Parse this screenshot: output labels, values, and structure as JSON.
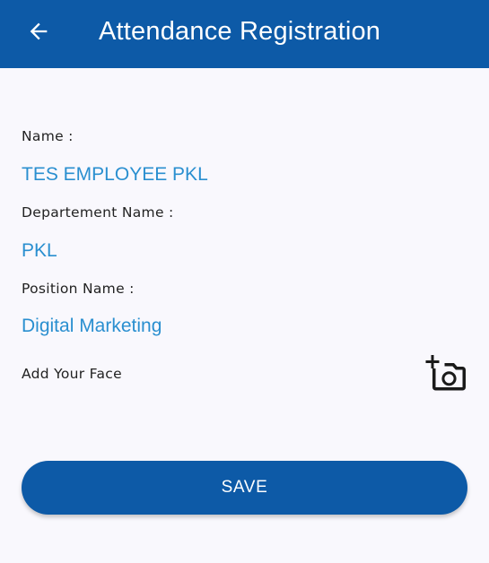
{
  "app_bar": {
    "title": "Attendance Registration",
    "back_icon": "arrow-left-icon",
    "background": "#0d5aa7"
  },
  "form": {
    "name_label": "Name :",
    "name_value": "TES EMPLOYEE PKL",
    "department_label": "Departement Name :",
    "department_value": "PKL",
    "position_label": "Position Name :",
    "position_value": "Digital Marketing",
    "face_label": "Add Your Face",
    "face_icon": "add-a-photo-icon",
    "value_color": "#2a8fd0"
  },
  "actions": {
    "save_label": "SAVE"
  }
}
